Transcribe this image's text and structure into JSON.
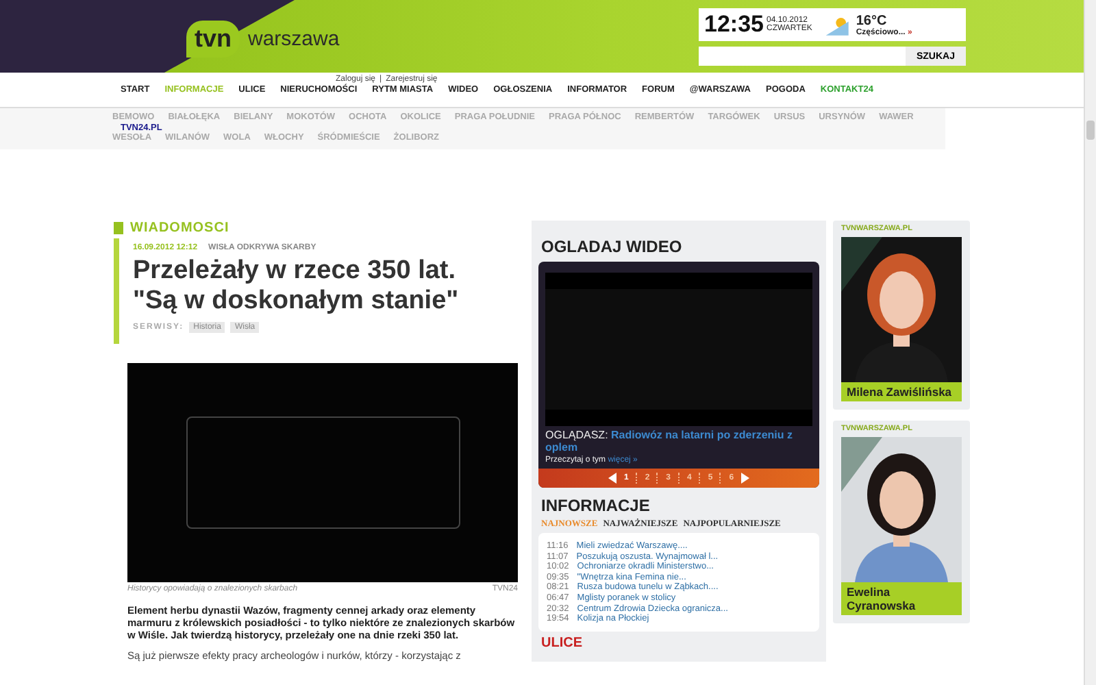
{
  "header": {
    "logo_brand": "tvn",
    "logo_name": "warszawa",
    "time": "12:35",
    "date": "04.10.2012",
    "weekday": "CZWARTEK",
    "temperature": "16°C",
    "weather": "Częściowo...",
    "weather_more": "»",
    "search_button": "SZUKAJ"
  },
  "account": {
    "login": "Zaloguj się",
    "separator": "|",
    "register": "Zarejestruj się"
  },
  "nav": [
    {
      "label": "START",
      "selected": false,
      "kind": "tab"
    },
    {
      "label": "INFORMACJE",
      "selected": true,
      "kind": "tab"
    },
    {
      "label": "ULICE",
      "selected": false,
      "kind": "tab"
    },
    {
      "label": "NIERUCHOMOŚCI",
      "selected": false,
      "kind": "tab"
    },
    {
      "label": "RYTM MIASTA",
      "selected": false,
      "kind": "tab"
    },
    {
      "label": "WIDEO",
      "selected": false,
      "kind": "tab"
    },
    {
      "label": "OGŁOSZENIA",
      "selected": false,
      "kind": "tab"
    },
    {
      "label": "INFORMATOR",
      "selected": false,
      "kind": "tab"
    },
    {
      "label": "FORUM",
      "selected": false,
      "kind": "tab"
    },
    {
      "label": "@WARSZAWA",
      "selected": false,
      "kind": "tab"
    },
    {
      "label": "POGODA",
      "selected": false,
      "kind": "tab"
    },
    {
      "label": "KONTAKT24",
      "selected": false,
      "kind": "promo"
    }
  ],
  "districts": [
    "BEMOWO",
    "BIAŁOŁĘKA",
    "BIELANY",
    "MOKOTÓW",
    "OCHOTA",
    "OKOLICE",
    "PRAGA POŁUDNIE",
    "PRAGA PÓŁNOC",
    "REMBERTÓW",
    "TARGÓWEK",
    "URSUS",
    "URSYNÓW",
    "WAWER",
    "WESOŁA",
    "WILANÓW",
    "WOLA",
    "WŁOCHY",
    "ŚRÓDMIEŚCIE",
    "ŻOLIBORZ"
  ],
  "tvn24_link": "TVN24.PL",
  "article": {
    "section": "WIADOMOSCI",
    "date": "16.09.2012 12:12",
    "topic": "WISŁA ODKRYWA SKARBY",
    "title": "Przeleżały w rzece 350 lat. \"Są w doskonałym stanie\"",
    "services_label": "SERWISY:",
    "tags": [
      "Historia",
      "Wisła"
    ],
    "caption": "Historycy opowiadają o znalezionych skarbach",
    "source": "TVN24",
    "lead": "Element herbu dynastii Wazów, fragmenty cennej arkady oraz elementy marmuru z królewskich posiadłości - to tylko niektóre ze znalezionych skarbów w Wiśle. Jak twierdzą historycy, przeleżały one na dnie rzeki 350 lat.",
    "body": "Są już pierwsze efekty pracy archeologów i nurków, którzy - korzystając z"
  },
  "video": {
    "heading": "OGLADAJ WIDEO",
    "watching_label": "OGLĄDASZ:",
    "watching_title": "Radiowóz na latarni po zderzeniu z oplem",
    "read_label": "Przeczytaj o tym",
    "more": "więcej »",
    "pages": [
      {
        "label": "1",
        "selected": true
      },
      {
        "label": "2",
        "selected": false
      },
      {
        "label": "3",
        "selected": false
      },
      {
        "label": "4",
        "selected": false
      },
      {
        "label": "5",
        "selected": false
      },
      {
        "label": "6",
        "selected": false
      }
    ]
  },
  "news": {
    "heading": "INFORMACJE",
    "tabs": [
      {
        "label": "NAJNOWSZE",
        "selected": true
      },
      {
        "label": "NAJWAŻNIEJSZE",
        "selected": false
      },
      {
        "label": "NAJPOPULARNIEJSZE",
        "selected": false
      }
    ],
    "items": [
      {
        "time": "11:16",
        "title": "Mieli zwiedzać Warszawę...."
      },
      {
        "time": "11:07",
        "title": "Poszukują oszusta. Wynajmował l..."
      },
      {
        "time": "10:02",
        "title": "Ochroniarze okradli Ministerstwo..."
      },
      {
        "time": "09:35",
        "title": "\"Wnętrza kina Femina nie..."
      },
      {
        "time": "08:21",
        "title": "Rusza budowa tunelu w Ząbkach...."
      },
      {
        "time": "06:47",
        "title": "Mglisty poranek w stolicy"
      },
      {
        "time": "20:32",
        "title": "Centrum Zdrowia Dziecka ogranicza..."
      },
      {
        "time": "19:54",
        "title": "Kolizja na Płockiej"
      }
    ]
  },
  "next_heading": "ULICE",
  "people": [
    {
      "site": "TVNWARSZAWA.PL",
      "name": "Milena Zawiślińska",
      "kind": "dark"
    },
    {
      "site": "TVNWARSZAWA.PL",
      "name": "Ewelina Cyranowska",
      "kind": "light"
    }
  ]
}
